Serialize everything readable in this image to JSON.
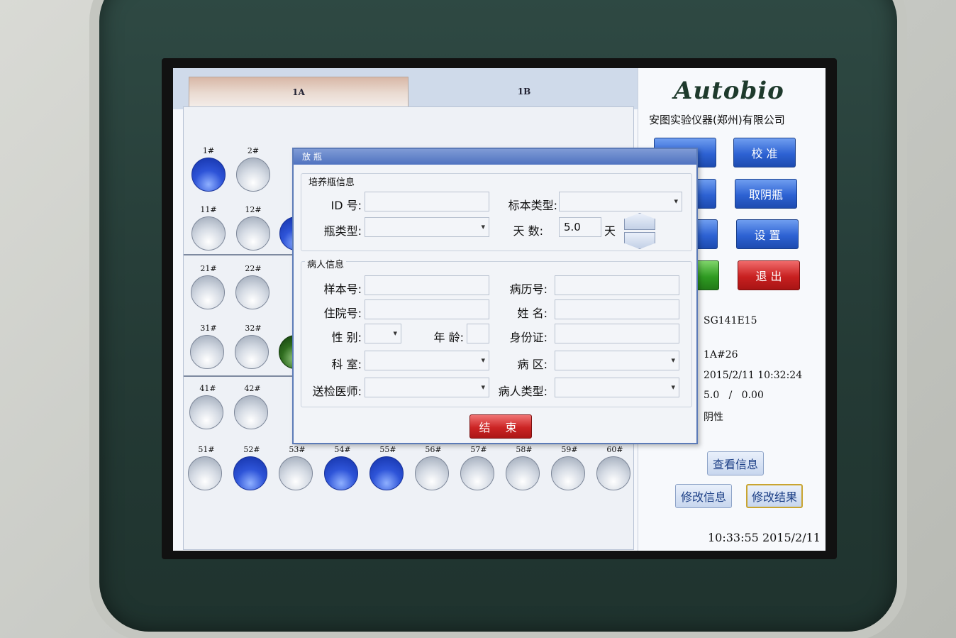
{
  "tabs": [
    {
      "label": "1A"
    },
    {
      "label": "1B"
    }
  ],
  "wells": {
    "row1": [
      {
        "label": "1#",
        "state": "blue"
      },
      {
        "label": "2#",
        "state": "empty"
      }
    ],
    "row2": [
      {
        "label": "11#",
        "state": "empty"
      },
      {
        "label": "12#",
        "state": "empty"
      }
    ],
    "row3": [
      {
        "label": "21#",
        "state": "empty"
      },
      {
        "label": "22#",
        "state": "empty"
      }
    ],
    "row4": [
      {
        "label": "31#",
        "state": "empty"
      },
      {
        "label": "32#",
        "state": "empty"
      }
    ],
    "row5": [
      {
        "label": "41#",
        "state": "empty"
      },
      {
        "label": "42#",
        "state": "empty"
      }
    ],
    "row6": [
      {
        "label": "51#",
        "state": "empty"
      },
      {
        "label": "52#",
        "state": "blue"
      },
      {
        "label": "53#",
        "state": "empty"
      },
      {
        "label": "54#",
        "state": "blue"
      },
      {
        "label": "55#",
        "state": "blue"
      },
      {
        "label": "56#",
        "state": "empty"
      },
      {
        "label": "57#",
        "state": "empty"
      },
      {
        "label": "58#",
        "state": "empty"
      },
      {
        "label": "59#",
        "state": "empty"
      },
      {
        "label": "60#",
        "state": "empty"
      }
    ]
  },
  "brand": {
    "logo": "Autobio",
    "company": "安图实验仪器(郑州)有限公司"
  },
  "buttons": {
    "calibrate": "校 准",
    "take_negative": "取阴瓶",
    "settings": "设 置",
    "exit": "退 出"
  },
  "info": {
    "barcode": "SG141E15",
    "position": "1A#26",
    "time": "2015/2/11 10:32:24",
    "values": "5.0   /   0.00",
    "result": "阴性"
  },
  "info_buttons": {
    "view": "查看信息",
    "edit_info": "修改信息",
    "edit_result": "修改结果"
  },
  "clock": "10:33:55 2015/2/11",
  "dialog": {
    "title": "放 瓶",
    "bottle_group": "培养瓶信息",
    "patient_group": "病人信息",
    "labels": {
      "id": "ID  号:",
      "specimen_type": "标本类型:",
      "bottle_type": "瓶类型:",
      "days": "天  数:",
      "days_unit": "天",
      "sample_no": "样本号:",
      "record_no": "病历号:",
      "inpatient_no": "住院号:",
      "name": "姓  名:",
      "sex": "性  别:",
      "age": "年 龄:",
      "id_card": "身份证:",
      "department": "科  室:",
      "ward": "病  区:",
      "doctor": "送检医师:",
      "patient_type": "病人类型:"
    },
    "values": {
      "days": "5.0"
    },
    "end_button": "结 束"
  }
}
